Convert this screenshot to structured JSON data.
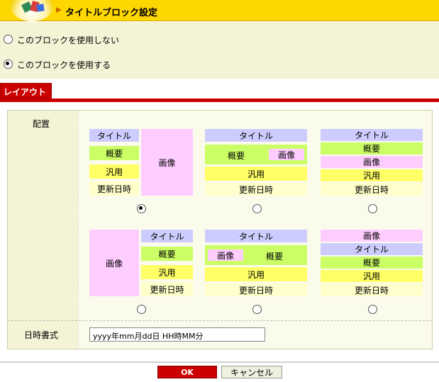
{
  "header": {
    "title": "タイトルブロック設定"
  },
  "options": {
    "dont_use": "このブロックを使用しない",
    "use": "このブロックを使用する",
    "selected": "use"
  },
  "tabs": {
    "layout": "レイアウト"
  },
  "form": {
    "placement_label": "配置",
    "date_format_label": "日時書式",
    "date_format_value": "yyyy年mm月dd日 HH時MM分"
  },
  "blocks": {
    "title": "タイトル",
    "summary": "概要",
    "general": "汎用",
    "datetime": "更新日時",
    "image": "画像"
  },
  "layouts": {
    "selected_index": 0,
    "count": 6
  },
  "buttons": {
    "ok": "OK",
    "cancel": "キャンセル"
  },
  "colors": {
    "header": "#ffd700",
    "accent": "#cc0000",
    "title_block": "#ccccff",
    "summary_block": "#ccff66",
    "general_block": "#ffff66",
    "datetime_block": "#ffffcc",
    "image_block": "#ffccff"
  }
}
